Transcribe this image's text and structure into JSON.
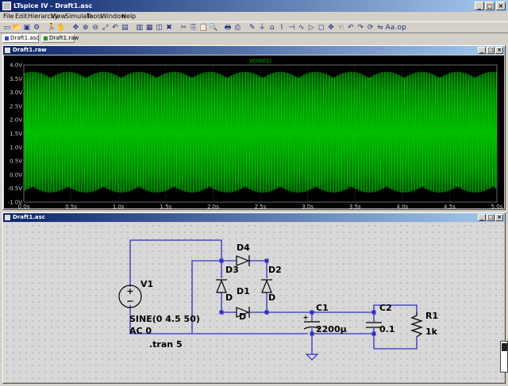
{
  "window": {
    "title": "LTspice IV - Draft1.asc"
  },
  "menu": [
    "File",
    "Edit",
    "Hierarchy",
    "View",
    "Simulate",
    "Tools",
    "Window",
    "Help"
  ],
  "toolbar_icons": [
    "new-icon",
    "open-icon",
    "save-icon",
    "control-panel-icon",
    "run-icon",
    "halt-icon",
    "pan-icon",
    "zoom-in-icon",
    "zoom-out-icon",
    "zoom-full-icon",
    "zoom-back-icon",
    "autorange-icon",
    "tile-horizontal-icon",
    "tile-vertical-icon",
    "cascade-icon",
    "close-all-icon",
    "cut-icon",
    "copy-icon",
    "paste-icon",
    "find-icon",
    "print-setup-icon",
    "print-icon",
    "wire-icon",
    "ground-icon",
    "label-icon",
    "resistor-icon",
    "capacitor-icon",
    "inductor-icon",
    "diode-icon",
    "component-icon",
    "move-icon",
    "drag-icon",
    "undo-icon",
    "redo-icon",
    "rotate-icon",
    "mirror-icon",
    "text-icon",
    "spice-directive-icon"
  ],
  "tabs": [
    {
      "label": "Draft1.asc",
      "active": true
    },
    {
      "label": "Draft1.raw",
      "active": false
    }
  ],
  "waveform": {
    "title": "Draft1.raw",
    "trace_label": "V(n001)",
    "trace_color": "#00c000",
    "grid_color": "#5a5a5a",
    "axis_label_color": "#c8c8c8"
  },
  "chart_data": {
    "type": "line",
    "series": [
      {
        "name": "V(n001)",
        "color": "#00c000",
        "description_values": {
          "frequency_hz": 50,
          "max": 3.75,
          "min": -0.65
        }
      }
    ],
    "xlim": [
      0,
      5
    ],
    "ylim": [
      -1.0,
      4.0
    ],
    "x_ticks": [
      "0.0s",
      "0.5s",
      "1.0s",
      "1.5s",
      "2.0s",
      "2.5s",
      "3.0s",
      "3.5s",
      "4.0s",
      "4.5s",
      "5.0s"
    ],
    "y_ticks": [
      "4.0V",
      "3.5V",
      "3.0V",
      "2.5V",
      "2.0V",
      "1.5V",
      "1.0V",
      "0.5V",
      "0.0V",
      "-0.5V",
      "-1.0V"
    ],
    "grid": true
  },
  "schematic": {
    "title": "Draft1.asc",
    "components": {
      "v1": {
        "name": "V1",
        "value": "SINE(0 4.5 50)",
        "ac": "AC 0"
      },
      "d1": {
        "name": "D1",
        "model": "D"
      },
      "d2": {
        "name": "D2",
        "model": "D"
      },
      "d3": {
        "name": "D3",
        "model": "D"
      },
      "d4": {
        "name": "D4",
        "model": "D"
      },
      "c1": {
        "name": "C1",
        "value": "2200µ"
      },
      "c2": {
        "name": "C2",
        "value": "0.1"
      },
      "r1": {
        "name": "R1",
        "value": "1k"
      }
    },
    "directive": ".tran 5",
    "wire_color": "#3030c0",
    "component_color": "#000000"
  }
}
